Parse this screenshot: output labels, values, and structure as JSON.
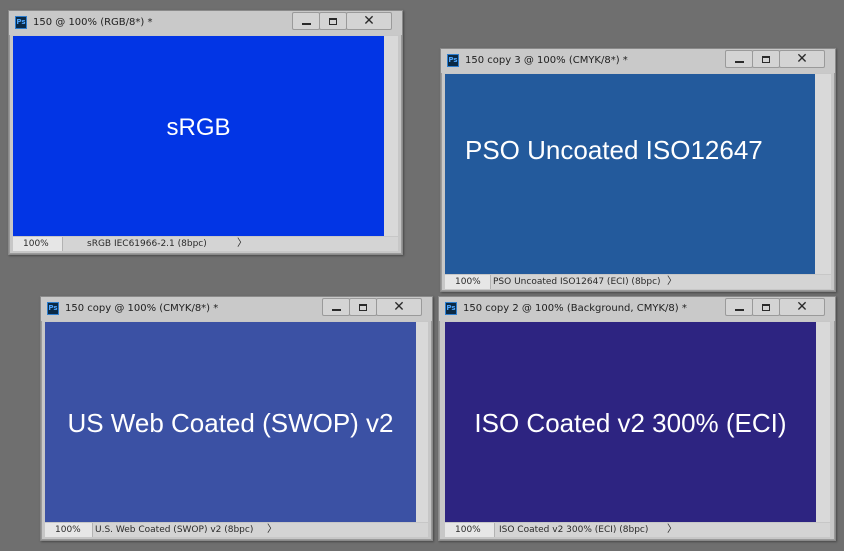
{
  "windows": [
    {
      "id": "srgb",
      "title": "150 @ 100% (RGB/8*) *",
      "canvas_text": "sRGB",
      "canvas_color": "#0235e5",
      "zoom": "100%",
      "profile": "sRGB IEC61966-2.1 (8bpc)"
    },
    {
      "id": "pso",
      "title": "150 copy 3 @ 100% (CMYK/8*) *",
      "canvas_text": "PSO Uncoated ISO12647",
      "canvas_color": "#235a9c",
      "zoom": "100%",
      "profile": "PSO Uncoated ISO12647 (ECI) (8bpc)"
    },
    {
      "id": "swop",
      "title": "150 copy @ 100% (CMYK/8*) *",
      "canvas_text": "US Web Coated (SWOP) v2",
      "canvas_color": "#3b51a4",
      "zoom": "100%",
      "profile": "U.S. Web Coated (SWOP) v2 (8bpc)"
    },
    {
      "id": "iso",
      "title": "150 copy 2 @ 100% (Background, CMYK/8) *",
      "canvas_text": "ISO Coated v2 300% (ECI)",
      "canvas_color": "#2d2481",
      "zoom": "100%",
      "profile": "ISO Coated v2 300% (ECI) (8bpc)"
    }
  ],
  "icons": {
    "app": "photoshop-logo-icon",
    "minimize": "minimize-icon",
    "maximize": "maximize-icon",
    "close": "close-icon",
    "status_menu": "chevron-right-icon"
  },
  "colors": {
    "workspace_bg": "#6f6f6f",
    "window_chrome": "#c7c7c7"
  }
}
